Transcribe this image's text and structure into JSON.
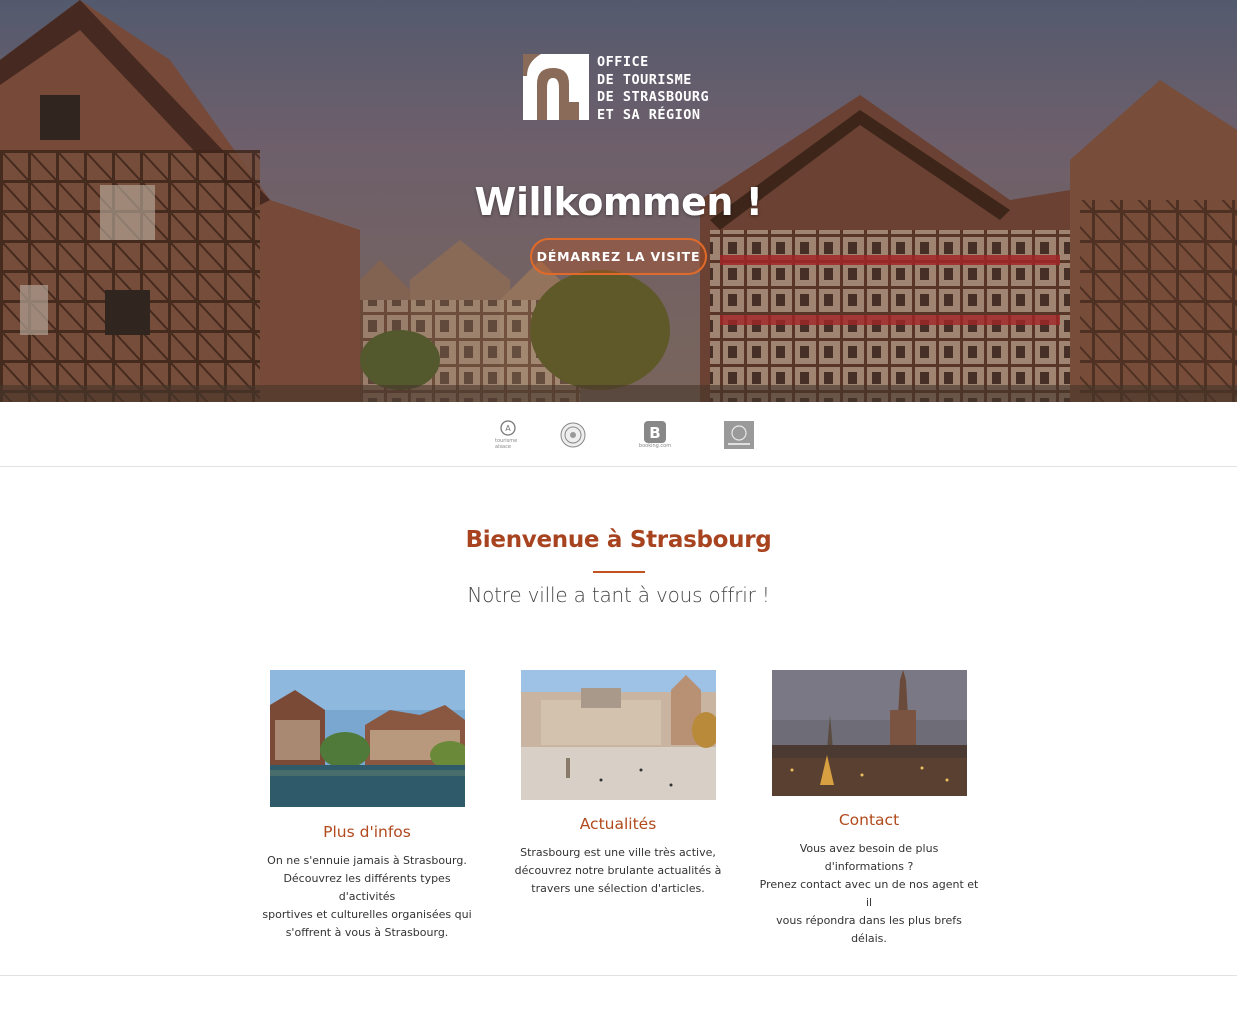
{
  "hero": {
    "logo_lines": [
      "OFFICE",
      "DE TOURISME",
      "DE STRASBOURG",
      "ET SA RÉGION"
    ],
    "title": "Willkommen !",
    "button_label": "DÉMARREZ LA VISITE"
  },
  "partners": [
    {
      "name": "tourisme-alsace-logo",
      "label": "tourisme alsace"
    },
    {
      "name": "strasbourg-seal-logo",
      "label": ""
    },
    {
      "name": "booking-logo",
      "label": "booking.com"
    },
    {
      "name": "partner-badge-logo",
      "label": ""
    }
  ],
  "welcome": {
    "title": "Bienvenue à Strasbourg",
    "subtitle": "Notre ville a tant à vous offrir !"
  },
  "cards": [
    {
      "title": "Plus d'infos",
      "lines": [
        "On ne s'ennuie jamais à Strasbourg.",
        "Découvrez les différents types d'activités",
        "sportives et culturelles organisées qui",
        "s'offrent à vous à Strasbourg."
      ]
    },
    {
      "title": "Actualités",
      "lines": [
        "Strasbourg est une ville très active,",
        "découvrez notre brulante actualités à",
        "travers une sélection d'articles."
      ]
    },
    {
      "title": "Contact",
      "lines": [
        "Vous avez besoin de plus d'informations ?",
        "Prenez contact avec un de nos agent et il",
        "vous répondra dans les plus brefs délais."
      ]
    }
  ],
  "colors": {
    "accent": "#b14a1c",
    "button_border": "#e06a2a"
  }
}
